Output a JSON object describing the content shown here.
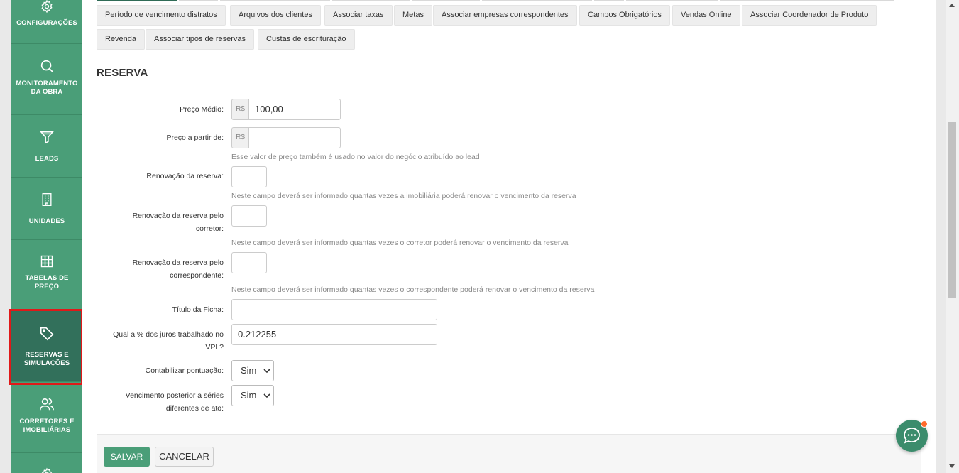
{
  "sidebar": {
    "items": [
      {
        "label": "CONFIGURAÇÕES",
        "icon": "gear-icon"
      },
      {
        "label": "MONITORAMENTO DA OBRA",
        "icon": "search-icon"
      },
      {
        "label": "LEADS",
        "icon": "funnel-icon"
      },
      {
        "label": "UNIDADES",
        "icon": "building-icon"
      },
      {
        "label": "TABELAS DE PREÇO",
        "icon": "grid-icon"
      },
      {
        "label": "RESERVAS E SIMULAÇÕES",
        "icon": "tag-icon",
        "active": true
      },
      {
        "label": "CORRETORES E IMOBILIÁRIAS",
        "icon": "users-icon"
      }
    ]
  },
  "tabs": [
    "Período de vencimento distratos",
    "Arquivos dos clientes",
    "Associar taxas",
    "Metas",
    "Associar empresas correspondentes",
    "Campos Obrigatórios",
    "Vendas Online",
    "Associar Coordenador de Produto",
    "Revenda",
    "Associar tipos de reservas",
    "Custas de escrituração"
  ],
  "section": {
    "title": "RESERVA"
  },
  "form": {
    "preco_medio": {
      "label": "Preço Médio:",
      "addon": "R$",
      "value": "100,00"
    },
    "preco_partir": {
      "label": "Preço a partir de:",
      "addon": "R$",
      "value": "",
      "hint": "Esse valor de preço também é usado no valor do negócio atribuído ao lead"
    },
    "renovacao": {
      "label": "Renovação da reserva:",
      "value": "",
      "hint": "Neste campo deverá ser informado quantas vezes a imobiliária poderá renovar o vencimento da reserva"
    },
    "renovacao_corretor": {
      "label_line1": "Renovação da reserva pelo",
      "label_line2": "corretor:",
      "value": "",
      "hint": "Neste campo deverá ser informado quantas vezes o corretor poderá renovar o vencimento da reserva"
    },
    "renovacao_correspondente": {
      "label_line1": "Renovação da reserva pelo",
      "label_line2": "correspondente:",
      "value": "",
      "hint": "Neste campo deverá ser informado quantas vezes o correspondente poderá renovar o vencimento da reserva"
    },
    "titulo_ficha": {
      "label": "Título da Ficha:",
      "value": ""
    },
    "juros_vpl": {
      "label_line1": "Qual a % dos juros trabalhado no",
      "label_line2": "VPL?",
      "value": "0.212255"
    },
    "pontuacao": {
      "label": "Contabilizar pontuação:",
      "selected": "Sim"
    },
    "vencimento_posterior": {
      "label_line1": "Vencimento posterior a séries",
      "label_line2": "diferentes de ato:",
      "selected": "Sim"
    }
  },
  "actions": {
    "save": "SALVAR",
    "cancel": "CANCELAR"
  },
  "colors": {
    "sidebar": "#4a9e78",
    "sidebar_active": "#32705b",
    "highlight": "#e01919",
    "chat": "#3b8c6c",
    "notification": "#ff6a2b"
  }
}
